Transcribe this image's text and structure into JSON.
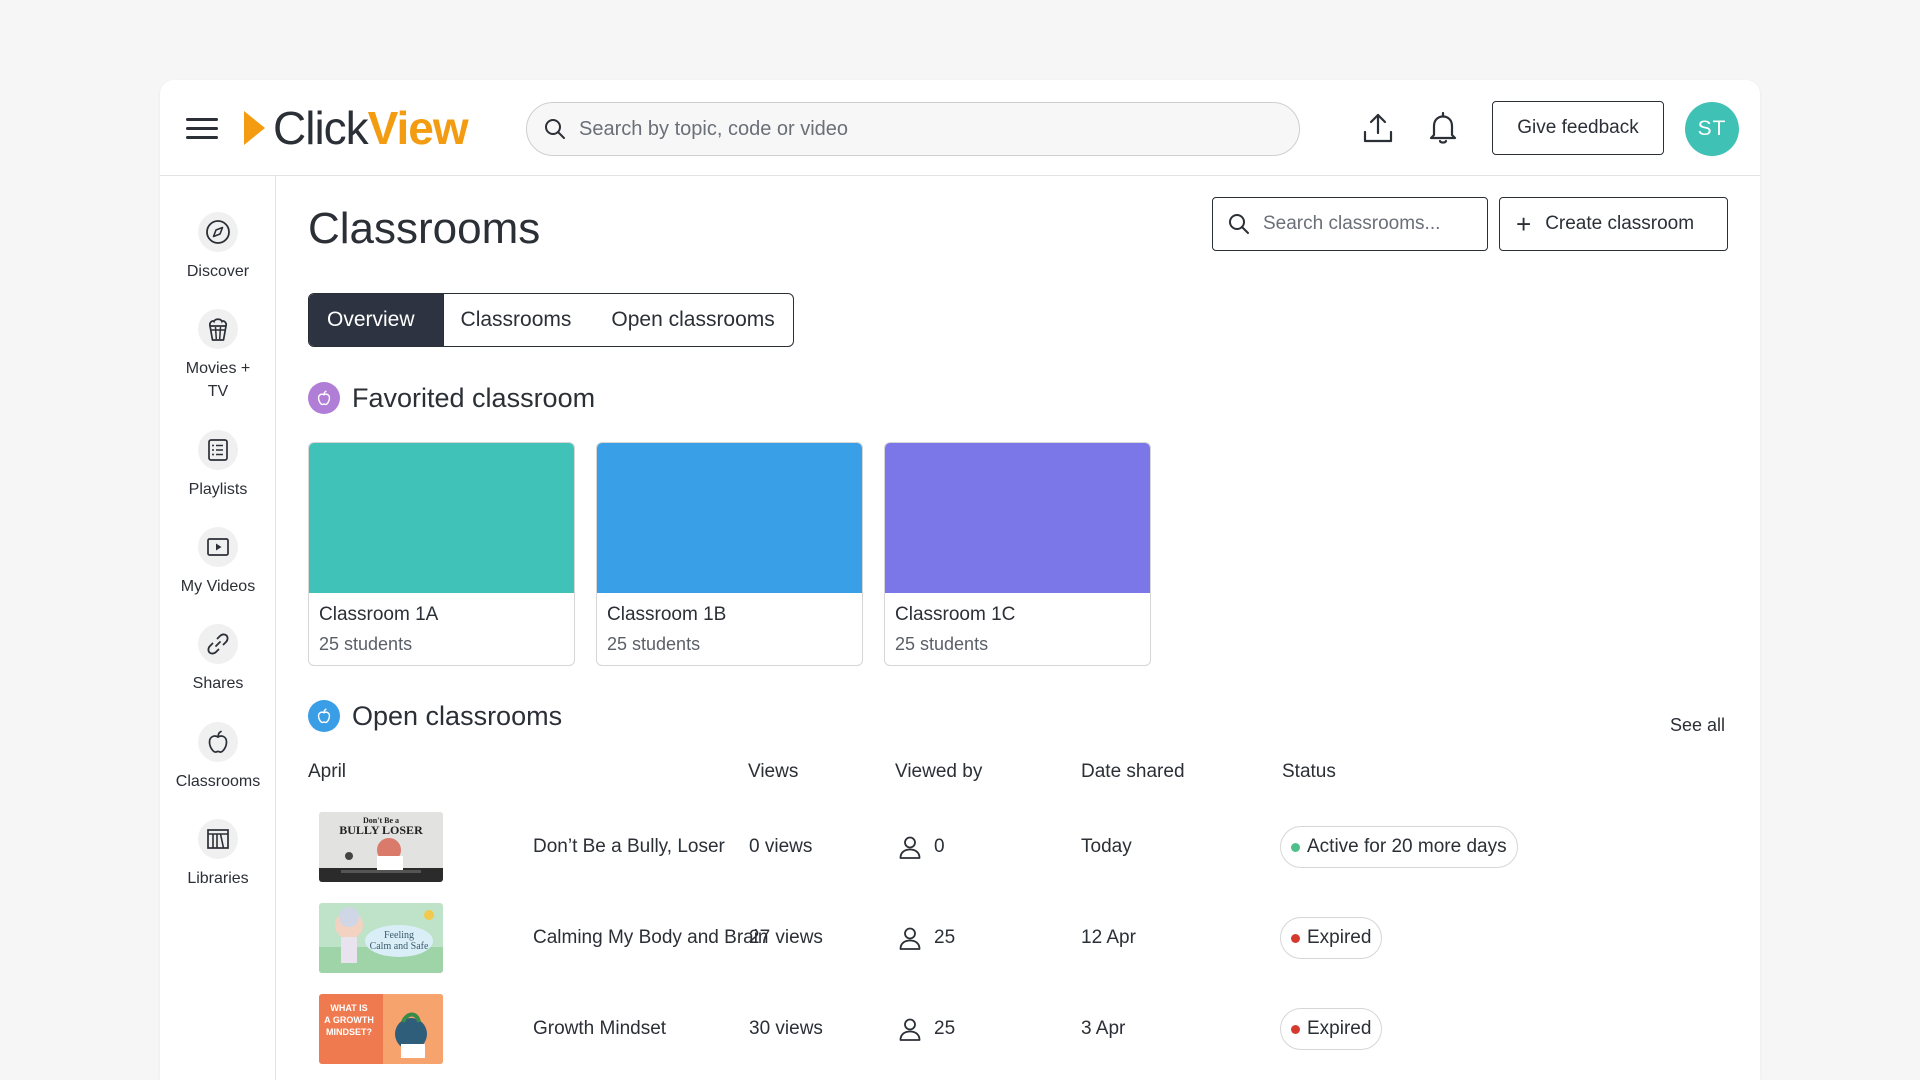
{
  "header": {
    "logo_click": "Click",
    "logo_view": "View",
    "search_placeholder": "Search by topic, code or video",
    "feedback_label": "Give feedback",
    "avatar_initials": "ST"
  },
  "sidebar": {
    "items": [
      {
        "label": "Discover",
        "icon": "compass-icon"
      },
      {
        "label": "Movies +\nTV",
        "icon": "popcorn-icon"
      },
      {
        "label": "Playlists",
        "icon": "list-icon"
      },
      {
        "label": "My Videos",
        "icon": "play-icon"
      },
      {
        "label": "Shares",
        "icon": "link-icon"
      },
      {
        "label": "Classrooms",
        "icon": "apple-icon"
      },
      {
        "label": "Libraries",
        "icon": "library-icon"
      }
    ]
  },
  "main": {
    "title": "Classrooms",
    "search_placeholder": "Search classrooms...",
    "create_label": "Create classroom",
    "tabs": [
      {
        "label": "Overview",
        "active": true
      },
      {
        "label": "Classrooms",
        "active": false
      },
      {
        "label": "Open classrooms",
        "active": false
      }
    ],
    "favorited_title": "Favorited classroom",
    "favorited": [
      {
        "name": "Classroom 1A",
        "students": "25 students",
        "color": "#40c2b8"
      },
      {
        "name": "Classroom 1B",
        "students": "25 students",
        "color": "#399fe6"
      },
      {
        "name": "Classroom 1C",
        "students": "25 students",
        "color": "#7c77e8"
      }
    ],
    "open_title": "Open classrooms",
    "see_all": "See all",
    "table": {
      "headers": [
        "April",
        "Views",
        "Viewed by",
        "Date shared",
        "Status"
      ],
      "rows": [
        {
          "title": "Don’t Be a Bully, Loser",
          "views": "0 views",
          "viewed_by": "0",
          "date": "Today",
          "status": "Active for 20 more days",
          "status_color": "#4cbf8a",
          "thumb_text": "Don't Be a\nBULLY LOSER"
        },
        {
          "title": "Calming My Body and Brain",
          "views": "27 views",
          "viewed_by": "25",
          "date": "12 Apr",
          "status": "Expired",
          "status_color": "#d63a2f",
          "thumb_text": "Feeling\nCalm and Safe"
        },
        {
          "title": "Growth Mindset",
          "views": "30 views",
          "viewed_by": "25",
          "date": "3 Apr",
          "status": "Expired",
          "status_color": "#d63a2f",
          "thumb_text": "WHAT IS\nA GROWTH\nMINDSET?"
        }
      ]
    }
  },
  "colors": {
    "accent_orange": "#f39c12",
    "avatar_teal": "#3fc1b5",
    "favorited_dot": "#b07ed6",
    "open_dot": "#3a9ee6"
  }
}
